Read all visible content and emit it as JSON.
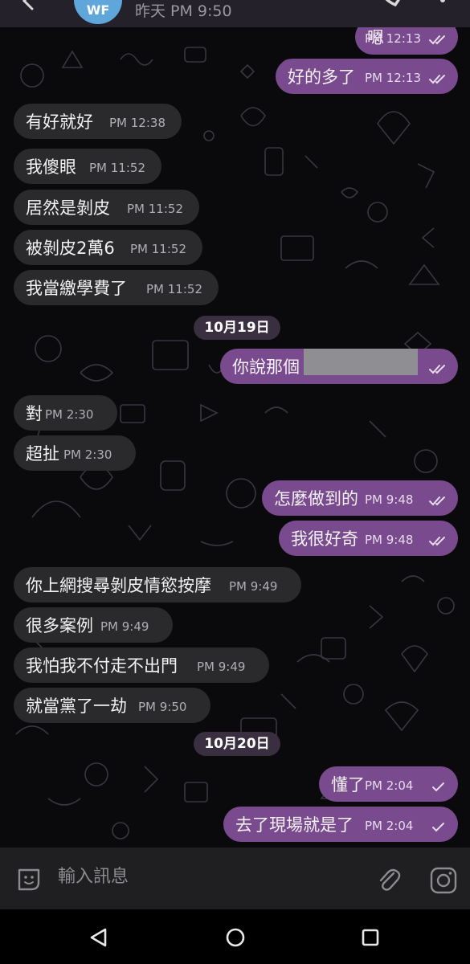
{
  "header": {
    "avatar_initials": "WF",
    "last_seen": "昨天 PM 9:50",
    "icons": [
      "back-arrow-icon",
      "call-icon",
      "more-vert-icon"
    ]
  },
  "colors": {
    "incoming_bubble": "#2a2a2d",
    "outgoing_bubble": "#7a4a8f",
    "date_chip": "#3a2f40",
    "chat_background": "#0a0a0c",
    "avatar": "#5fa6da"
  },
  "dates": [
    "10月19日",
    "10月20日"
  ],
  "messages": [
    {
      "dir": "out",
      "text": "嗯",
      "time": "PM 12:13",
      "status": "read"
    },
    {
      "dir": "out",
      "text": "好的多了",
      "time": "PM 12:13",
      "status": "read"
    },
    {
      "dir": "in",
      "text": "有好就好",
      "time": "PM 12:38"
    },
    {
      "dir": "in",
      "text": "我傻眼",
      "time": "PM 11:52"
    },
    {
      "dir": "in",
      "text": "居然是剝皮",
      "time": "PM 11:52"
    },
    {
      "dir": "in",
      "text": "被剝皮2萬6",
      "time": "PM 11:52"
    },
    {
      "dir": "in",
      "text": "我當繳學費了",
      "time": "PM 11:52"
    },
    {
      "dir": "out",
      "text": "你說那個",
      "time": "",
      "status": "read",
      "redacted": true
    },
    {
      "dir": "in",
      "text": "對",
      "time": "PM 2:30"
    },
    {
      "dir": "in",
      "text": "超扯",
      "time": "PM 2:30"
    },
    {
      "dir": "out",
      "text": "怎麼做到的",
      "time": "PM 9:48",
      "status": "read"
    },
    {
      "dir": "out",
      "text": "我很好奇",
      "time": "PM 9:48",
      "status": "read"
    },
    {
      "dir": "in",
      "text": "你上網搜尋剝皮情慾按摩",
      "time": "PM 9:49"
    },
    {
      "dir": "in",
      "text": "很多案例",
      "time": "PM 9:49"
    },
    {
      "dir": "in",
      "text": "我怕我不付走不出門",
      "time": "PM 9:49"
    },
    {
      "dir": "in",
      "text": "就當黨了一劫",
      "time": "PM 9:50"
    },
    {
      "dir": "out",
      "text": "懂了",
      "time": "PM 2:04",
      "status": "sent"
    },
    {
      "dir": "out",
      "text": "去了現場就是了",
      "time": "PM 2:04",
      "status": "sent"
    }
  ],
  "input": {
    "placeholder": "輸入訊息",
    "icons": [
      "emoji-icon",
      "attach-icon",
      "camera-icon"
    ]
  },
  "nav": {
    "icons": [
      "nav-back-icon",
      "nav-home-icon",
      "nav-recents-icon"
    ]
  }
}
